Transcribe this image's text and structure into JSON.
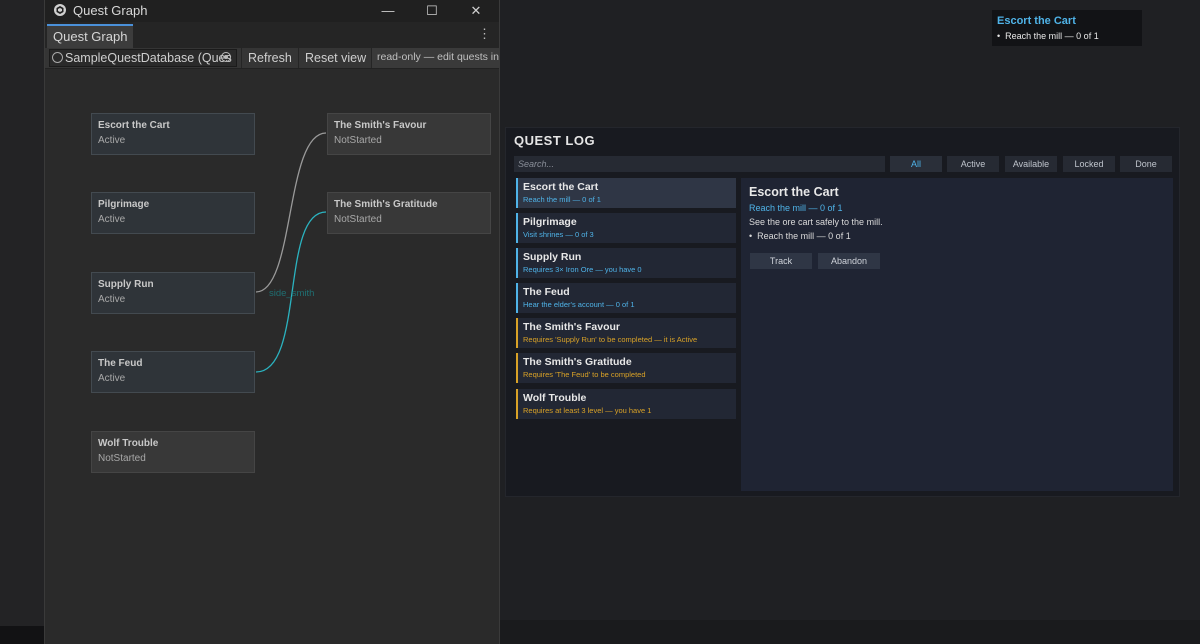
{
  "graph_window": {
    "title": "Quest Graph",
    "controls": {
      "minimize": "—",
      "maximize": "☐",
      "close": "✕"
    },
    "tab": "Quest Graph",
    "kebab": "⋮",
    "toolbar": {
      "database": "SampleQuestDatabase (Ques",
      "refresh": "Refresh",
      "reset_view": "Reset view",
      "note": "read-only — edit quests in th"
    },
    "nodes": [
      {
        "name": "Escort the Cart",
        "status": "Active"
      },
      {
        "name": "Pilgrimage",
        "status": "Active"
      },
      {
        "name": "Supply Run",
        "status": "Active"
      },
      {
        "name": "The Feud",
        "status": "Active"
      },
      {
        "name": "Wolf Trouble",
        "status": "NotStarted"
      },
      {
        "name": "The Smith's Favour",
        "status": "NotStarted"
      },
      {
        "name": "The Smith's Gratitude",
        "status": "NotStarted"
      }
    ],
    "edge_label": "side_smith",
    "edge_colors": {
      "supply_to_favour": "#9a9a9a",
      "feud_to_gratitude": "#2bb3c0"
    }
  },
  "tracker": {
    "title": "Escort the Cart",
    "objective": "Reach the mill — 0 of 1"
  },
  "quest_log": {
    "title": "QUEST LOG",
    "search_placeholder": "Search...",
    "filters": [
      "All",
      "Active",
      "Available",
      "Locked",
      "Done"
    ],
    "selected_filter": "All",
    "items": [
      {
        "name": "Escort the Cart",
        "sub": "Reach the mill — 0 of 1",
        "state": "active"
      },
      {
        "name": "Pilgrimage",
        "sub": "Visit shrines — 0 of 3",
        "state": "active"
      },
      {
        "name": "Supply Run",
        "sub": "Requires 3× Iron Ore — you have 0",
        "state": "active"
      },
      {
        "name": "The Feud",
        "sub": "Hear the elder's account — 0 of 1",
        "state": "active"
      },
      {
        "name": "The Smith's Favour",
        "sub": "Requires 'Supply Run' to be completed — it is Active",
        "state": "locked"
      },
      {
        "name": "The Smith's Gratitude",
        "sub": "Requires 'The Feud' to be completed",
        "state": "locked"
      },
      {
        "name": "Wolf Trouble",
        "sub": "Requires at least 3 level — you have 1",
        "state": "locked"
      }
    ],
    "detail": {
      "title": "Escort the Cart",
      "objective_link": "Reach the mill — 0 of 1",
      "description": "See the ore cart safely to the mill.",
      "objective": "Reach the mill — 0 of 1",
      "track": "Track",
      "abandon": "Abandon"
    },
    "colors": {
      "accent": "#4fb3e8",
      "locked": "#d9a227"
    }
  }
}
